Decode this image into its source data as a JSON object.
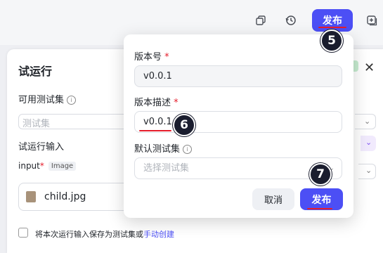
{
  "toolbar": {
    "publish_label": "发布",
    "icons": [
      "copy-icon",
      "history-icon",
      "add-icon"
    ]
  },
  "annotations": {
    "step_5": "5",
    "step_6": "6",
    "step_7": "7",
    "badge_color": "#1a1d2e",
    "underline_color": "#e51d2b"
  },
  "trial_panel": {
    "title": "试运行",
    "test_set_label": "可用测试集",
    "test_set_placeholder": "测试集",
    "input_section_label": "试运行输入",
    "input_name": "input",
    "required_mark": "*",
    "input_type_tag": "Image",
    "file_name": "child.jpg",
    "save_text": "将本次运行输入保存为测试集或",
    "save_link": "手动创建"
  },
  "modal": {
    "version_label": "版本号",
    "version_value": "v0.0.1",
    "description_label": "版本描述",
    "description_value": "v0.0.1",
    "default_test_set_label": "默认测试集",
    "default_test_set_placeholder": "选择测试集",
    "cancel_label": "取消",
    "publish_label": "发布",
    "required_mark": "*"
  },
  "colors": {
    "accent": "#4c4ff5",
    "required": "#e51d2b"
  }
}
